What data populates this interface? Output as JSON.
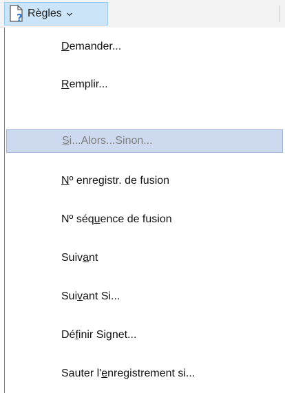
{
  "ribbon": {
    "rules_button": {
      "icon": "document-question-icon",
      "label": "Règles",
      "dropdown_icon": "chevron-down-icon"
    }
  },
  "menu": {
    "items": [
      {
        "pre": "",
        "key": "D",
        "post": "emander...",
        "state": "normal"
      },
      {
        "pre": "",
        "key": "R",
        "post": "emplir...",
        "state": "normal"
      },
      {
        "pre": "",
        "key": "S",
        "post": "i...Alors...Sinon...",
        "state": "highlighted-disabled"
      },
      {
        "pre": "",
        "key": "N",
        "post": "º enregistr. de fusion",
        "state": "normal"
      },
      {
        "pre": "Nº séq",
        "key": "u",
        "post": "ence de fusion",
        "state": "normal"
      },
      {
        "pre": "Suiv",
        "key": "a",
        "post": "nt",
        "state": "normal"
      },
      {
        "pre": "Sui",
        "key": "v",
        "post": "ant Si...",
        "state": "normal"
      },
      {
        "pre": "Dé",
        "key": "f",
        "post": "inir Signet...",
        "state": "normal"
      },
      {
        "pre": "Sauter l'",
        "key": "e",
        "post": "nregistrement si...",
        "state": "normal"
      }
    ]
  },
  "colors": {
    "highlight_bg": "#cdd9ee",
    "highlight_border": "#9eb5da",
    "button_bg": "#cce4f7",
    "disabled_text": "#7f7f7f"
  }
}
